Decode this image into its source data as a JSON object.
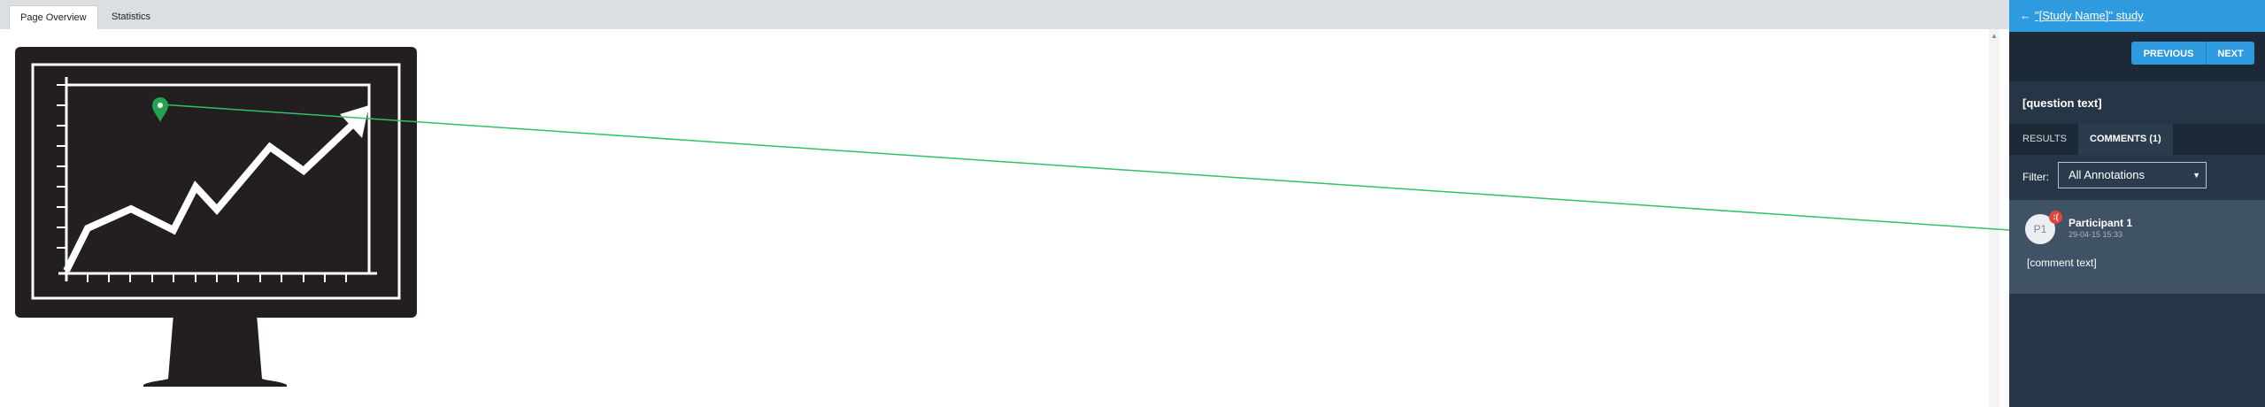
{
  "tabs": [
    {
      "label": "Page Overview",
      "active": true
    },
    {
      "label": "Statistics",
      "active": false
    }
  ],
  "canvas": {
    "image": "monitor-with-rising-chart-illustration",
    "pin_color": "#22a352",
    "connector_color": "#2fc26a"
  },
  "sidebar": {
    "back_arrow": "←",
    "back_label": "\"[Study Name]\" study",
    "nav": {
      "previous": "PREVIOUS",
      "next": "NEXT"
    },
    "question": "[question text]",
    "tabs": [
      {
        "label": "RESULTS",
        "active": false
      },
      {
        "label": "COMMENTS (1)",
        "active": true
      }
    ],
    "filter": {
      "label": "Filter:",
      "value": "All Annotations"
    },
    "comment": {
      "avatar_initials": "P1",
      "badge_icon": "sad-face-icon",
      "participant": "Participant 1",
      "date": "29-04-15 15:33",
      "text": "[comment text]"
    }
  },
  "colors": {
    "accent": "#2e9be0",
    "sidebar_bg": "#273646",
    "badge": "#e0463c"
  }
}
